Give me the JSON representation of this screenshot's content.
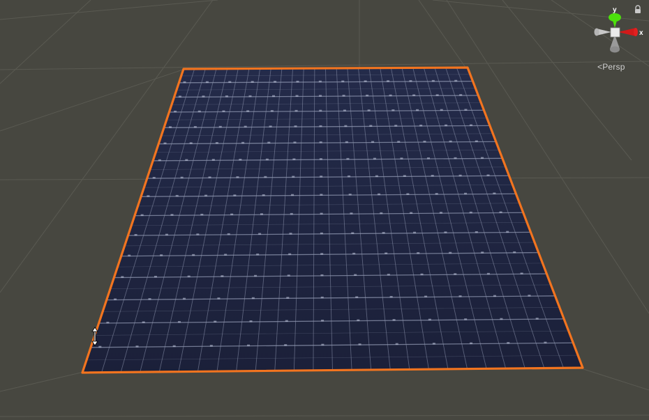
{
  "scene_view": {
    "gizmo": {
      "y_label": "y",
      "x_label": "x",
      "projection_label": "Persp",
      "x_axis_color": "#d11a1a",
      "y_axis_color": "#4ce00c",
      "neutral_axis_color": "#b5b5b5"
    },
    "selected_object": {
      "outline_color": "#f2741f",
      "panel_color": "#1c2240",
      "grid_line_color": "#8f97b0"
    },
    "tool_cursor": "vertical-resize-cursor"
  }
}
